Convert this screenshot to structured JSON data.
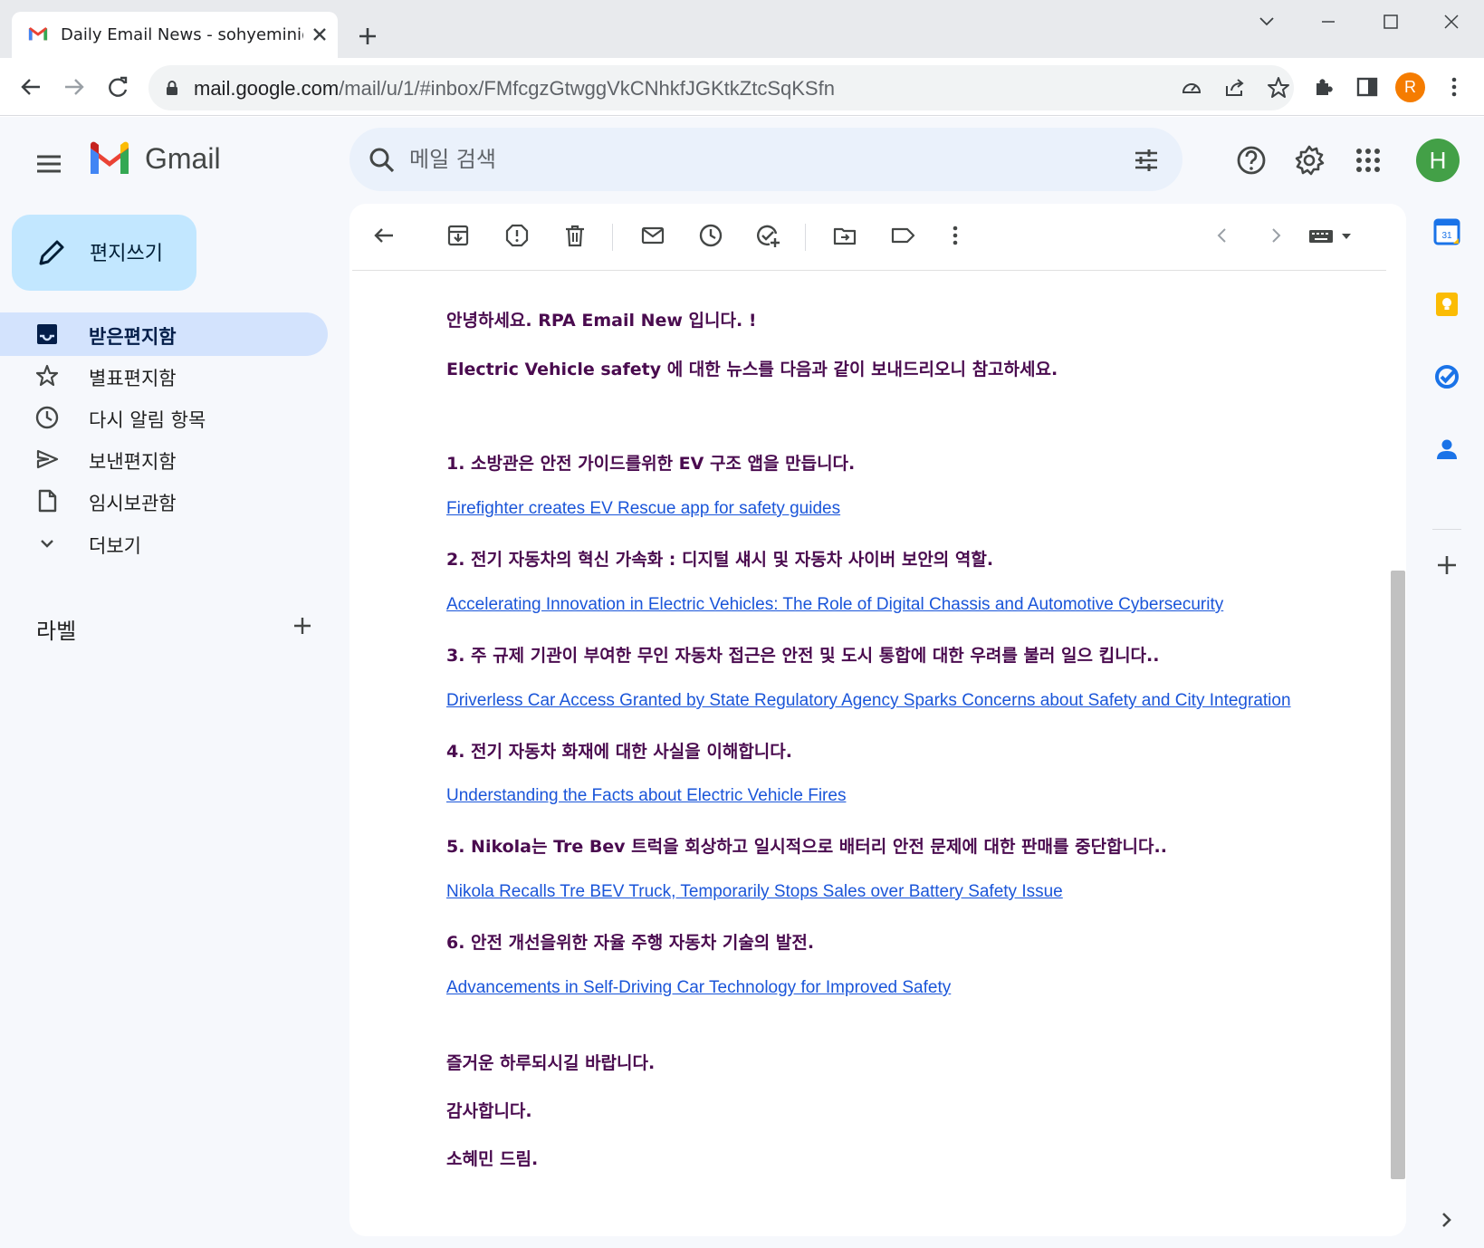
{
  "browser": {
    "tab_title": "Daily Email News - sohyemini@",
    "url_host": "mail.google.com",
    "url_path": "/mail/u/1/#inbox/FMfcgzGtwggVkCNhkfJGKtkZtcSqKSfn",
    "profile_initial": "R",
    "profile_color": "#f57c00"
  },
  "gmail": {
    "logo_text": "Gmail",
    "search_placeholder": "메일 검색",
    "account_initial": "H",
    "account_color": "#43a047"
  },
  "sidebar": {
    "compose_label": "편지쓰기",
    "items": [
      {
        "label": "받은편지함",
        "icon": "inbox-icon",
        "active": true
      },
      {
        "label": "별표편지함",
        "icon": "star-icon",
        "active": false
      },
      {
        "label": "다시 알림 항목",
        "icon": "clock-icon",
        "active": false
      },
      {
        "label": "보낸편지함",
        "icon": "send-icon",
        "active": false
      },
      {
        "label": "임시보관함",
        "icon": "draft-icon",
        "active": false
      },
      {
        "label": "더보기",
        "icon": "chevron-down-icon",
        "active": false
      }
    ],
    "labels_title": "라벨"
  },
  "message": {
    "greeting": "안녕하세요. RPA Email New 입니다. !",
    "intro": "Electric Vehicle safety 에 대한 뉴스를 다음과 같이 보내드리오니 참고하세요.",
    "news": [
      {
        "title": "1. 소방관은 안전 가이드를위한 EV 구조 앱을 만듭니다.",
        "link": "Firefighter creates EV Rescue app for safety guides"
      },
      {
        "title": "2. 전기 자동차의 혁신 가속화 : 디지털 섀시 및 자동차 사이버 보안의 역할.",
        "link": "Accelerating Innovation in Electric Vehicles: The Role of Digital Chassis and Automotive Cybersecurity"
      },
      {
        "title": "3. 주 규제 기관이 부여한 무인 자동차 접근은 안전 및 도시 통합에 대한 우려를 불러 일으 킵니다..",
        "link": "Driverless Car Access Granted by State Regulatory Agency Sparks Concerns about Safety and City Integration"
      },
      {
        "title": "4. 전기 자동차 화재에 대한 사실을 이해합니다.",
        "link": "Understanding the Facts about Electric Vehicle Fires"
      },
      {
        "title": "5. Nikola는 Tre Bev 트럭을 회상하고 일시적으로 배터리 안전 문제에 대한 판매를 중단합니다..",
        "link": "Nikola Recalls Tre BEV Truck, Temporarily Stops Sales over Battery Safety Issue"
      },
      {
        "title": "6. 안전 개선을위한 자율 주행 자동차 기술의 발전.",
        "link": "Advancements in Self-Driving Car Technology for Improved Safety"
      }
    ],
    "closing": "즐거운 하루되시길 바랍니다.",
    "thanks": "감사합니다.",
    "signature": "소혜민 드림.",
    "text_color": "#4a0b4f",
    "link_color": "#1a55d9"
  }
}
